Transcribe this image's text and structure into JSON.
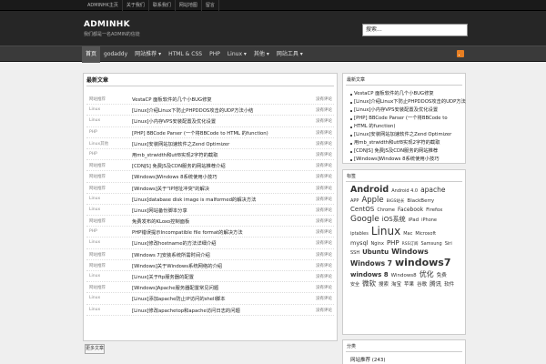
{
  "topbar": {
    "links": [
      "ADMINHK主页",
      "关于我们",
      "联系我们",
      "网站地图",
      "留言"
    ]
  },
  "header": {
    "brand": "ADMINHK",
    "tagline": "我们都是一名ADMIN的信徒",
    "search_value": "搜索..."
  },
  "nav": {
    "items": [
      {
        "label": "首页",
        "active": true
      },
      {
        "label": "godaddy"
      },
      {
        "label": "网站推荐 ▾"
      },
      {
        "label": "HTML & CSS"
      },
      {
        "label": "PHP"
      },
      {
        "label": "Linux ▾"
      },
      {
        "label": "其他 ▾"
      },
      {
        "label": "网站工具 ▾"
      }
    ]
  },
  "main": {
    "title": "最新文章",
    "rows": [
      {
        "cat": "网站推荐",
        "title": "VestaCP 面板软件的几个小BUG修复",
        "comment": "没有评论"
      },
      {
        "cat": "Linux",
        "title": "[Linux]介绍Linux下防止PHPDDOS攻击的UDP方法小结",
        "comment": "没有评论"
      },
      {
        "cat": "Linux",
        "title": "[Linux]小内存VPS安装配置及优化设置",
        "comment": "没有评论"
      },
      {
        "cat": "PHP",
        "title": "[PHP] BBCode Parser (一个将BBCode to HTML 的function)",
        "comment": "没有评论"
      },
      {
        "cat": "Linux其他",
        "title": "[Linux]安装网站加速软件之Zend Optimizer",
        "comment": "没有评论"
      },
      {
        "cat": "PHP",
        "title": "用mb_strwidth和utf8实现2字符的截取",
        "comment": "没有评论"
      },
      {
        "cat": "网站推荐",
        "title": "[CDNJS] 免费JS及CDN服务的网站推荐介绍",
        "comment": "没有评论"
      },
      {
        "cat": "网站推荐",
        "title": "[Windows]Windows 8系统使用小技巧",
        "comment": "没有评论"
      },
      {
        "cat": "网站推荐",
        "title": "[Windows]关于\"IP地址冲突\"的解决",
        "comment": "没有评论"
      },
      {
        "cat": "Linux",
        "title": "[Linux]database disk image is malformed的解决方法",
        "comment": "没有评论"
      },
      {
        "cat": "Linux",
        "title": "[Linux]网站备份脚本分享",
        "comment": "没有评论"
      },
      {
        "cat": "网站推荐",
        "title": "免费发布的KLoxo控制面板",
        "comment": "没有评论"
      },
      {
        "cat": "PHP",
        "title": "PHP错误提示Incompatible file format的解决方法",
        "comment": "没有评论"
      },
      {
        "cat": "Linux",
        "title": "[Linux]修改hostname的方法详细介绍",
        "comment": "没有评论"
      },
      {
        "cat": "网站推荐",
        "title": "[Windows 7]安装系统所需时间介绍",
        "comment": "没有评论"
      },
      {
        "cat": "网站推荐",
        "title": "[Windows]关于Windows系统网络的介绍",
        "comment": "没有评论"
      },
      {
        "cat": "Linux",
        "title": "[Linux]关于ftp服务器的配置",
        "comment": "没有评论"
      },
      {
        "cat": "网站推荐",
        "title": "[Windows]Apache服务器配置常见问题",
        "comment": "没有评论"
      },
      {
        "cat": "Linux",
        "title": "[Linux]添加apache防止IP访问的shell脚本",
        "comment": "没有评论"
      },
      {
        "cat": "Linux",
        "title": "[Linux]修改apachetop和apache访问日志的问题",
        "comment": "没有评论"
      }
    ],
    "more_label": "更多文章"
  },
  "widget_recent": {
    "title": "最新文章",
    "items": [
      "VestaCP 面板软件的几个小BUG修复",
      "[Linux]介绍Linux下防止PHPDDOS攻击的UDP方法",
      "[Linux]小内存VPS安装配置及优化设置",
      "[PHP] BBCode Parser (一个将BBCode to",
      "HTML 的function)",
      "[Linux]安装网站加速软件之Zend Optimizer",
      "用mb_strwidth和utf8实现2字符的截取",
      "[CDNJS] 免费JS及CDN服务的网站推荐",
      "[Windows]Windows 8系统使用小技巧"
    ]
  },
  "widget_tags": {
    "title": "标签",
    "tags": [
      {
        "t": "Android",
        "s": 9.5,
        "b": true
      },
      {
        "t": "Android 4.0",
        "s": 5
      },
      {
        "t": "apache",
        "s": 7.5
      },
      {
        "t": "APP",
        "s": 5
      },
      {
        "t": "Apple",
        "s": 8.5
      },
      {
        "t": "BIGS站长",
        "s": 4.5
      },
      {
        "t": "BlackBerry",
        "s": 5.5
      },
      {
        "t": "CentOS",
        "s": 7
      },
      {
        "t": "Chrome",
        "s": 5
      },
      {
        "t": "Facebook",
        "s": 6
      },
      {
        "t": "Firefox",
        "s": 5.5
      },
      {
        "t": "Google",
        "s": 9
      },
      {
        "t": "iOS系统",
        "s": 7
      },
      {
        "t": "iPad",
        "s": 5.5
      },
      {
        "t": "iPhone",
        "s": 5
      },
      {
        "t": "iptables",
        "s": 5
      },
      {
        "t": "Linux",
        "s": 12
      },
      {
        "t": "Mac",
        "s": 5
      },
      {
        "t": "Microsoft",
        "s": 5
      },
      {
        "t": "mysql",
        "s": 6.5
      },
      {
        "t": "Nginx",
        "s": 5
      },
      {
        "t": "PHP",
        "s": 7
      },
      {
        "t": "RSS订阅",
        "s": 4.5
      },
      {
        "t": "Samsung",
        "s": 5
      },
      {
        "t": "Siri",
        "s": 5
      },
      {
        "t": "SSH",
        "s": 5
      },
      {
        "t": "Ubuntu",
        "s": 7,
        "b": true
      },
      {
        "t": "Windows",
        "s": 8,
        "b": true
      },
      {
        "t": "Windows 7",
        "s": 7.5,
        "b": true
      },
      {
        "t": "windows7",
        "s": 11,
        "b": true
      },
      {
        "t": "windows 8",
        "s": 7,
        "b": true
      },
      {
        "t": "Windows8",
        "s": 5.5
      },
      {
        "t": "优化",
        "s": 8
      },
      {
        "t": "免费",
        "s": 5.5
      },
      {
        "t": "安全",
        "s": 5
      },
      {
        "t": "微软",
        "s": 7.5
      },
      {
        "t": "搜索",
        "s": 5.5
      },
      {
        "t": "淘宝",
        "s": 5.5
      },
      {
        "t": "苹果",
        "s": 5.5
      },
      {
        "t": "谷歌",
        "s": 5.5
      },
      {
        "t": "腾讯",
        "s": 6.5
      },
      {
        "t": "软件",
        "s": 5.5
      }
    ]
  },
  "widget_cats": {
    "title": "分类",
    "first": "网站推荐 (243)"
  }
}
